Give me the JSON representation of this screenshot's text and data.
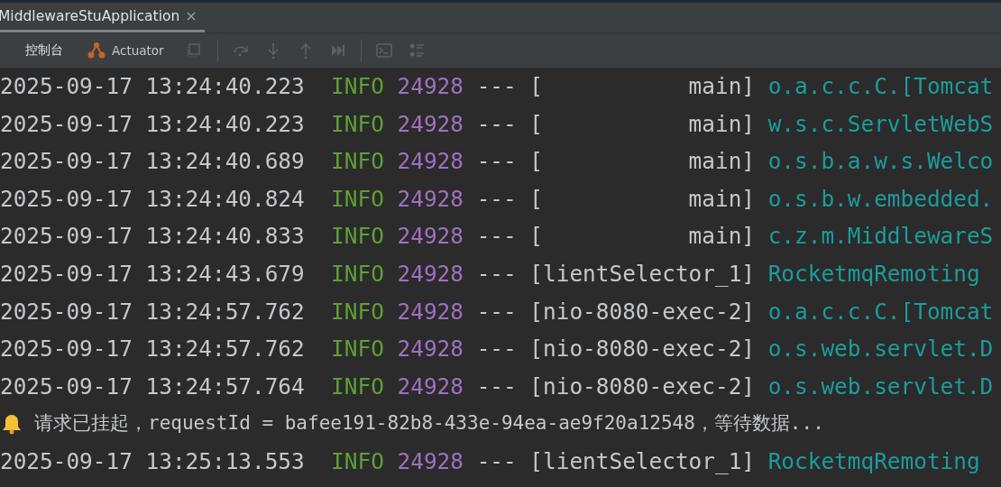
{
  "tab": {
    "title": "MiddlewareStuApplication",
    "selected": true
  },
  "toolbar": [
    {
      "kind": "tab",
      "label": "控制台",
      "selected": true
    },
    {
      "kind": "tab",
      "label": "Actuator",
      "selected": false
    },
    {
      "kind": "icon",
      "disabled": true
    },
    {
      "kind": "divider"
    },
    {
      "kind": "icon",
      "disabled": true
    },
    {
      "kind": "icon",
      "disabled": true
    },
    {
      "kind": "icon",
      "disabled": true
    },
    {
      "kind": "icon",
      "disabled": true
    },
    {
      "kind": "divider"
    },
    {
      "kind": "icon",
      "disabled": true
    },
    {
      "kind": "icon",
      "disabled": true
    }
  ],
  "console": [
    {
      "kind": "log",
      "time": "2025-09-17 13:24:40.223",
      "level": "INFO",
      "pid": "24928",
      "sep": "---",
      "thread": "[           main]",
      "logger": "o.a.c.c.C.[Tomcat"
    },
    {
      "kind": "log",
      "time": "2025-09-17 13:24:40.223",
      "level": "INFO",
      "pid": "24928",
      "sep": "---",
      "thread": "[           main]",
      "logger": "w.s.c.ServletWebS"
    },
    {
      "kind": "log",
      "time": "2025-09-17 13:24:40.689",
      "level": "INFO",
      "pid": "24928",
      "sep": "---",
      "thread": "[           main]",
      "logger": "o.s.b.a.w.s.Welco"
    },
    {
      "kind": "log",
      "time": "2025-09-17 13:24:40.824",
      "level": "INFO",
      "pid": "24928",
      "sep": "---",
      "thread": "[           main]",
      "logger": "o.s.b.w.embedded."
    },
    {
      "kind": "log",
      "time": "2025-09-17 13:24:40.833",
      "level": "INFO",
      "pid": "24928",
      "sep": "---",
      "thread": "[           main]",
      "logger": "c.z.m.MiddlewareS"
    },
    {
      "kind": "log",
      "time": "2025-09-17 13:24:43.679",
      "level": "INFO",
      "pid": "24928",
      "sep": "---",
      "thread": "[lientSelector_1]",
      "logger": "RocketmqRemoting"
    },
    {
      "kind": "log",
      "time": "2025-09-17 13:24:57.762",
      "level": "INFO",
      "pid": "24928",
      "sep": "---",
      "thread": "[nio-8080-exec-2]",
      "logger": "o.a.c.c.C.[Tomcat"
    },
    {
      "kind": "log",
      "time": "2025-09-17 13:24:57.762",
      "level": "INFO",
      "pid": "24928",
      "sep": "---",
      "thread": "[nio-8080-exec-2]",
      "logger": "o.s.web.servlet.D"
    },
    {
      "kind": "log",
      "time": "2025-09-17 13:24:57.764",
      "level": "INFO",
      "pid": "24928",
      "sep": "---",
      "thread": "[nio-8080-exec-2]",
      "logger": "o.s.web.servlet.D"
    },
    {
      "kind": "message",
      "text": "请求已挂起，requestId = bafee191-82b8-433e-94ea-ae9f20a12548，等待数据..."
    },
    {
      "kind": "log",
      "time": "2025-09-17 13:25:13.553",
      "level": "INFO",
      "pid": "24928",
      "sep": "---",
      "thread": "[lientSelector_1]",
      "logger": "RocketmqRemoting"
    }
  ]
}
